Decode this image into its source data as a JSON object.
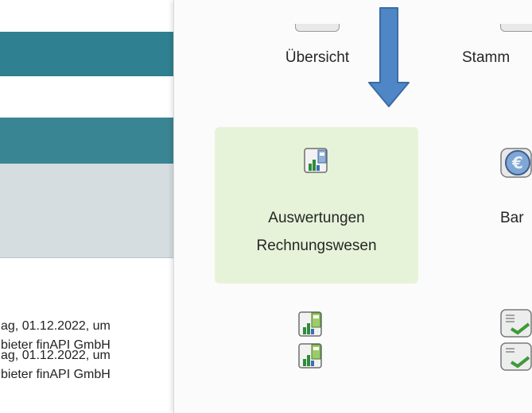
{
  "background_app": {
    "text_lines": [
      "ag, 01.12.2022, um",
      "bieter finAPI GmbH",
      "ag, 01.12.2022, um",
      "bieter finAPI GmbH"
    ]
  },
  "popup": {
    "tiles_top": [
      {
        "label": "Übersicht"
      },
      {
        "label": "Stamm"
      }
    ],
    "tile_selected": {
      "label_line1": "Auswertungen",
      "label_line2": "Rechnungswesen",
      "icon": "report-chart-icon"
    },
    "tile_right_partial": {
      "label": "Bar",
      "icon": "euro-coin-icon"
    },
    "bottom_icons": [
      "report-chart-green-icon",
      "report-chart-green-icon",
      "document-check-icon",
      "document-check-icon"
    ]
  },
  "annotation": {
    "arrow_color": "#4f86c6",
    "icon": "down-arrow-icon"
  },
  "colors": {
    "teal": "#2f8090",
    "selected_tile": "#e6f3d9",
    "grey_panel": "#d5dde1"
  }
}
